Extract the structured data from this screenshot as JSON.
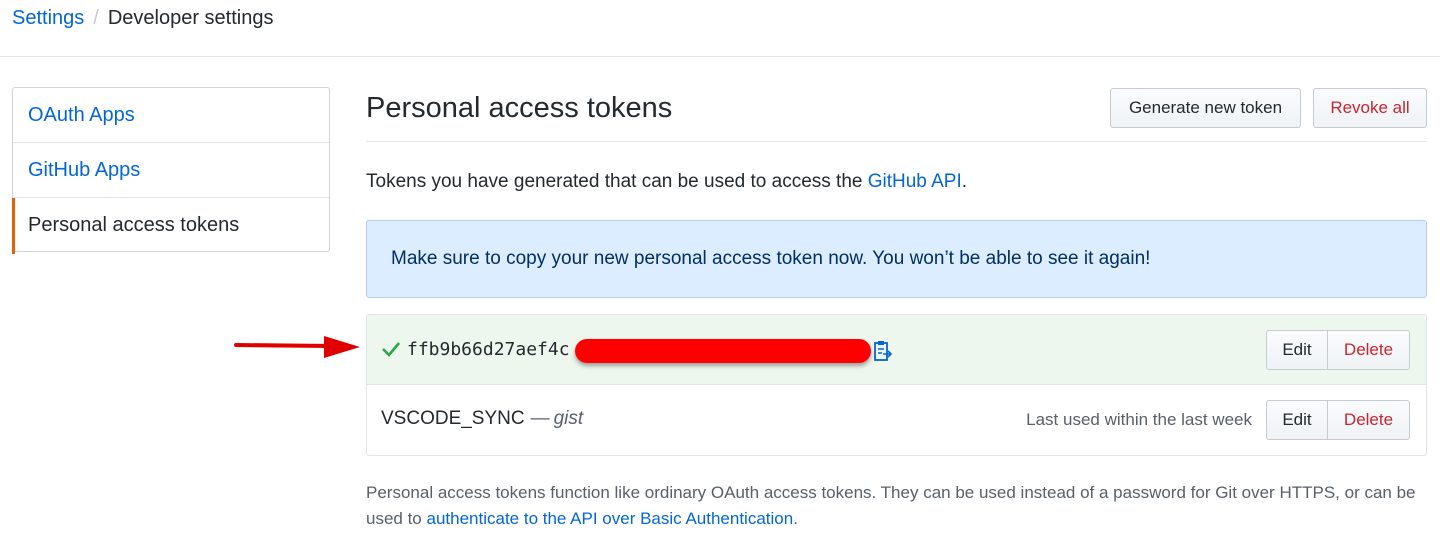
{
  "breadcrumb": {
    "parent": "Settings",
    "separator": "/",
    "current": "Developer settings"
  },
  "sidebar": {
    "items": [
      {
        "label": "OAuth Apps"
      },
      {
        "label": "GitHub Apps"
      },
      {
        "label": "Personal access tokens",
        "selected": true
      }
    ]
  },
  "main": {
    "title": "Personal access tokens",
    "generate_button": "Generate new token",
    "revoke_button": "Revoke all",
    "intro_text": "Tokens you have generated that can be used to access the ",
    "intro_link": "GitHub API",
    "intro_end": ".",
    "flash": "Make sure to copy your new personal access token now. You won’t be able to see it again!"
  },
  "tokens": [
    {
      "value_visible": "ffb9b66d27aef4c",
      "redacted": true,
      "icons": [
        "check-icon",
        "clipboard-icon"
      ],
      "edit_label": "Edit",
      "delete_label": "Delete"
    },
    {
      "name": "VSCODE_SYNC",
      "dash": "—",
      "scope": "gist",
      "last_used": "Last used within the last week",
      "edit_label": "Edit",
      "delete_label": "Delete"
    }
  ],
  "footer": {
    "text": "Personal access tokens function like ordinary OAuth access tokens. They can be used instead of a password for Git over HTTPS, or can be used to ",
    "link": "authenticate to the API over Basic Authentication",
    "end": "."
  },
  "colors": {
    "link": "#0366d6",
    "danger": "#cb2431",
    "flash_bg": "#dbedff",
    "new_token_bg": "#eef7ee",
    "selected_accent": "#e36209",
    "annotation_red": "#ff0000"
  }
}
